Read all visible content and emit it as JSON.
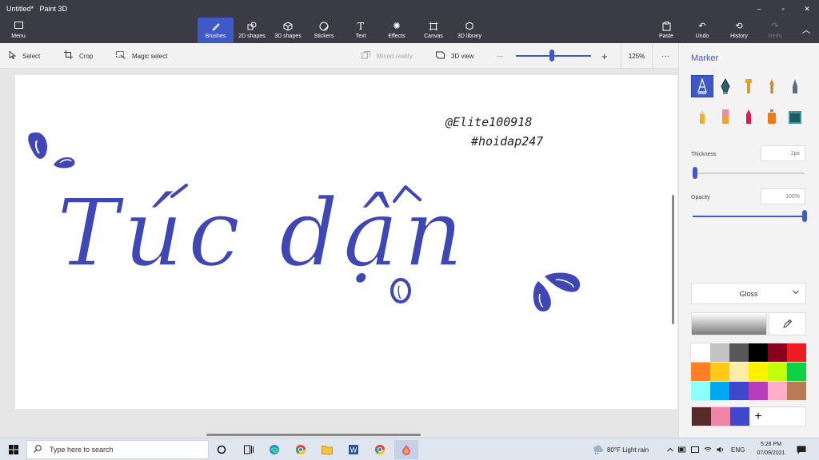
{
  "window": {
    "doc_title": "Untitled*",
    "app_name": "Paint 3D",
    "min_glyph": "–",
    "max_glyph": "▫",
    "close_glyph": "✕"
  },
  "ribbon": {
    "menu_label": "Menu",
    "tools": [
      {
        "label": "Brushes",
        "icon": "brush-icon",
        "glyph": "🖌"
      },
      {
        "label": "2D shapes",
        "icon": "2d-shapes-icon",
        "glyph": "⬡"
      },
      {
        "label": "3D shapes",
        "icon": "3d-shapes-icon",
        "glyph": "⬢"
      },
      {
        "label": "Stickers",
        "icon": "stickers-icon",
        "glyph": "◍"
      },
      {
        "label": "Text",
        "icon": "text-icon",
        "glyph": "T"
      },
      {
        "label": "Effects",
        "icon": "effects-icon",
        "glyph": "✺"
      },
      {
        "label": "Canvas",
        "icon": "canvas-icon",
        "glyph": "⌗"
      },
      {
        "label": "3D library",
        "icon": "3d-library-icon",
        "glyph": "⬙"
      }
    ],
    "right": [
      {
        "label": "Paste",
        "icon": "paste-icon",
        "glyph": "📋"
      },
      {
        "label": "Undo",
        "icon": "undo-icon",
        "glyph": "↶"
      },
      {
        "label": "History",
        "icon": "history-icon",
        "glyph": "⟲"
      },
      {
        "label": "Redo",
        "icon": "redo-icon",
        "glyph": "↷"
      }
    ],
    "collapse_glyph": "︿"
  },
  "toolbar": {
    "select": "Select",
    "crop": "Crop",
    "magic_select": "Magic select",
    "mixed_reality": "Mixed reality",
    "view_3d": "3D view",
    "zoom_minus": "—",
    "zoom_plus": "+",
    "zoom": "125%",
    "more": "···",
    "zoom_fraction": 0.46
  },
  "canvas": {
    "handle1": "@Elite100918",
    "handle2": "#hoidap247",
    "art_text": "Túc dận",
    "ink_color": "#3f47b4"
  },
  "panel": {
    "title": "Marker",
    "thickness_label": "Thickness",
    "thickness_value": "2px",
    "thickness_fraction": 0.0,
    "opacity_label": "Opacity",
    "opacity_value": "100%",
    "opacity_fraction": 1.0,
    "finish": "Gloss",
    "palette": [
      "#ffffff",
      "#c3c3c3",
      "#585858",
      "#000000",
      "#88001b",
      "#ec1c24",
      "#ff7f27",
      "#ffca18",
      "#fdeca6",
      "#fff200",
      "#c4ff0e",
      "#0ed145",
      "#8cfffb",
      "#00a8f3",
      "#3f48cc",
      "#b83dba",
      "#ffaec8",
      "#b97a56"
    ],
    "custom_colors": [
      "#582a28",
      "#f083a8",
      "#3f48cc"
    ],
    "add_color": "+"
  },
  "taskbar": {
    "search_placeholder": "Type here to search",
    "weather": "80°F  Light rain",
    "lang": "ENG",
    "time": "5:28 PM",
    "date": "07/09/2021"
  }
}
